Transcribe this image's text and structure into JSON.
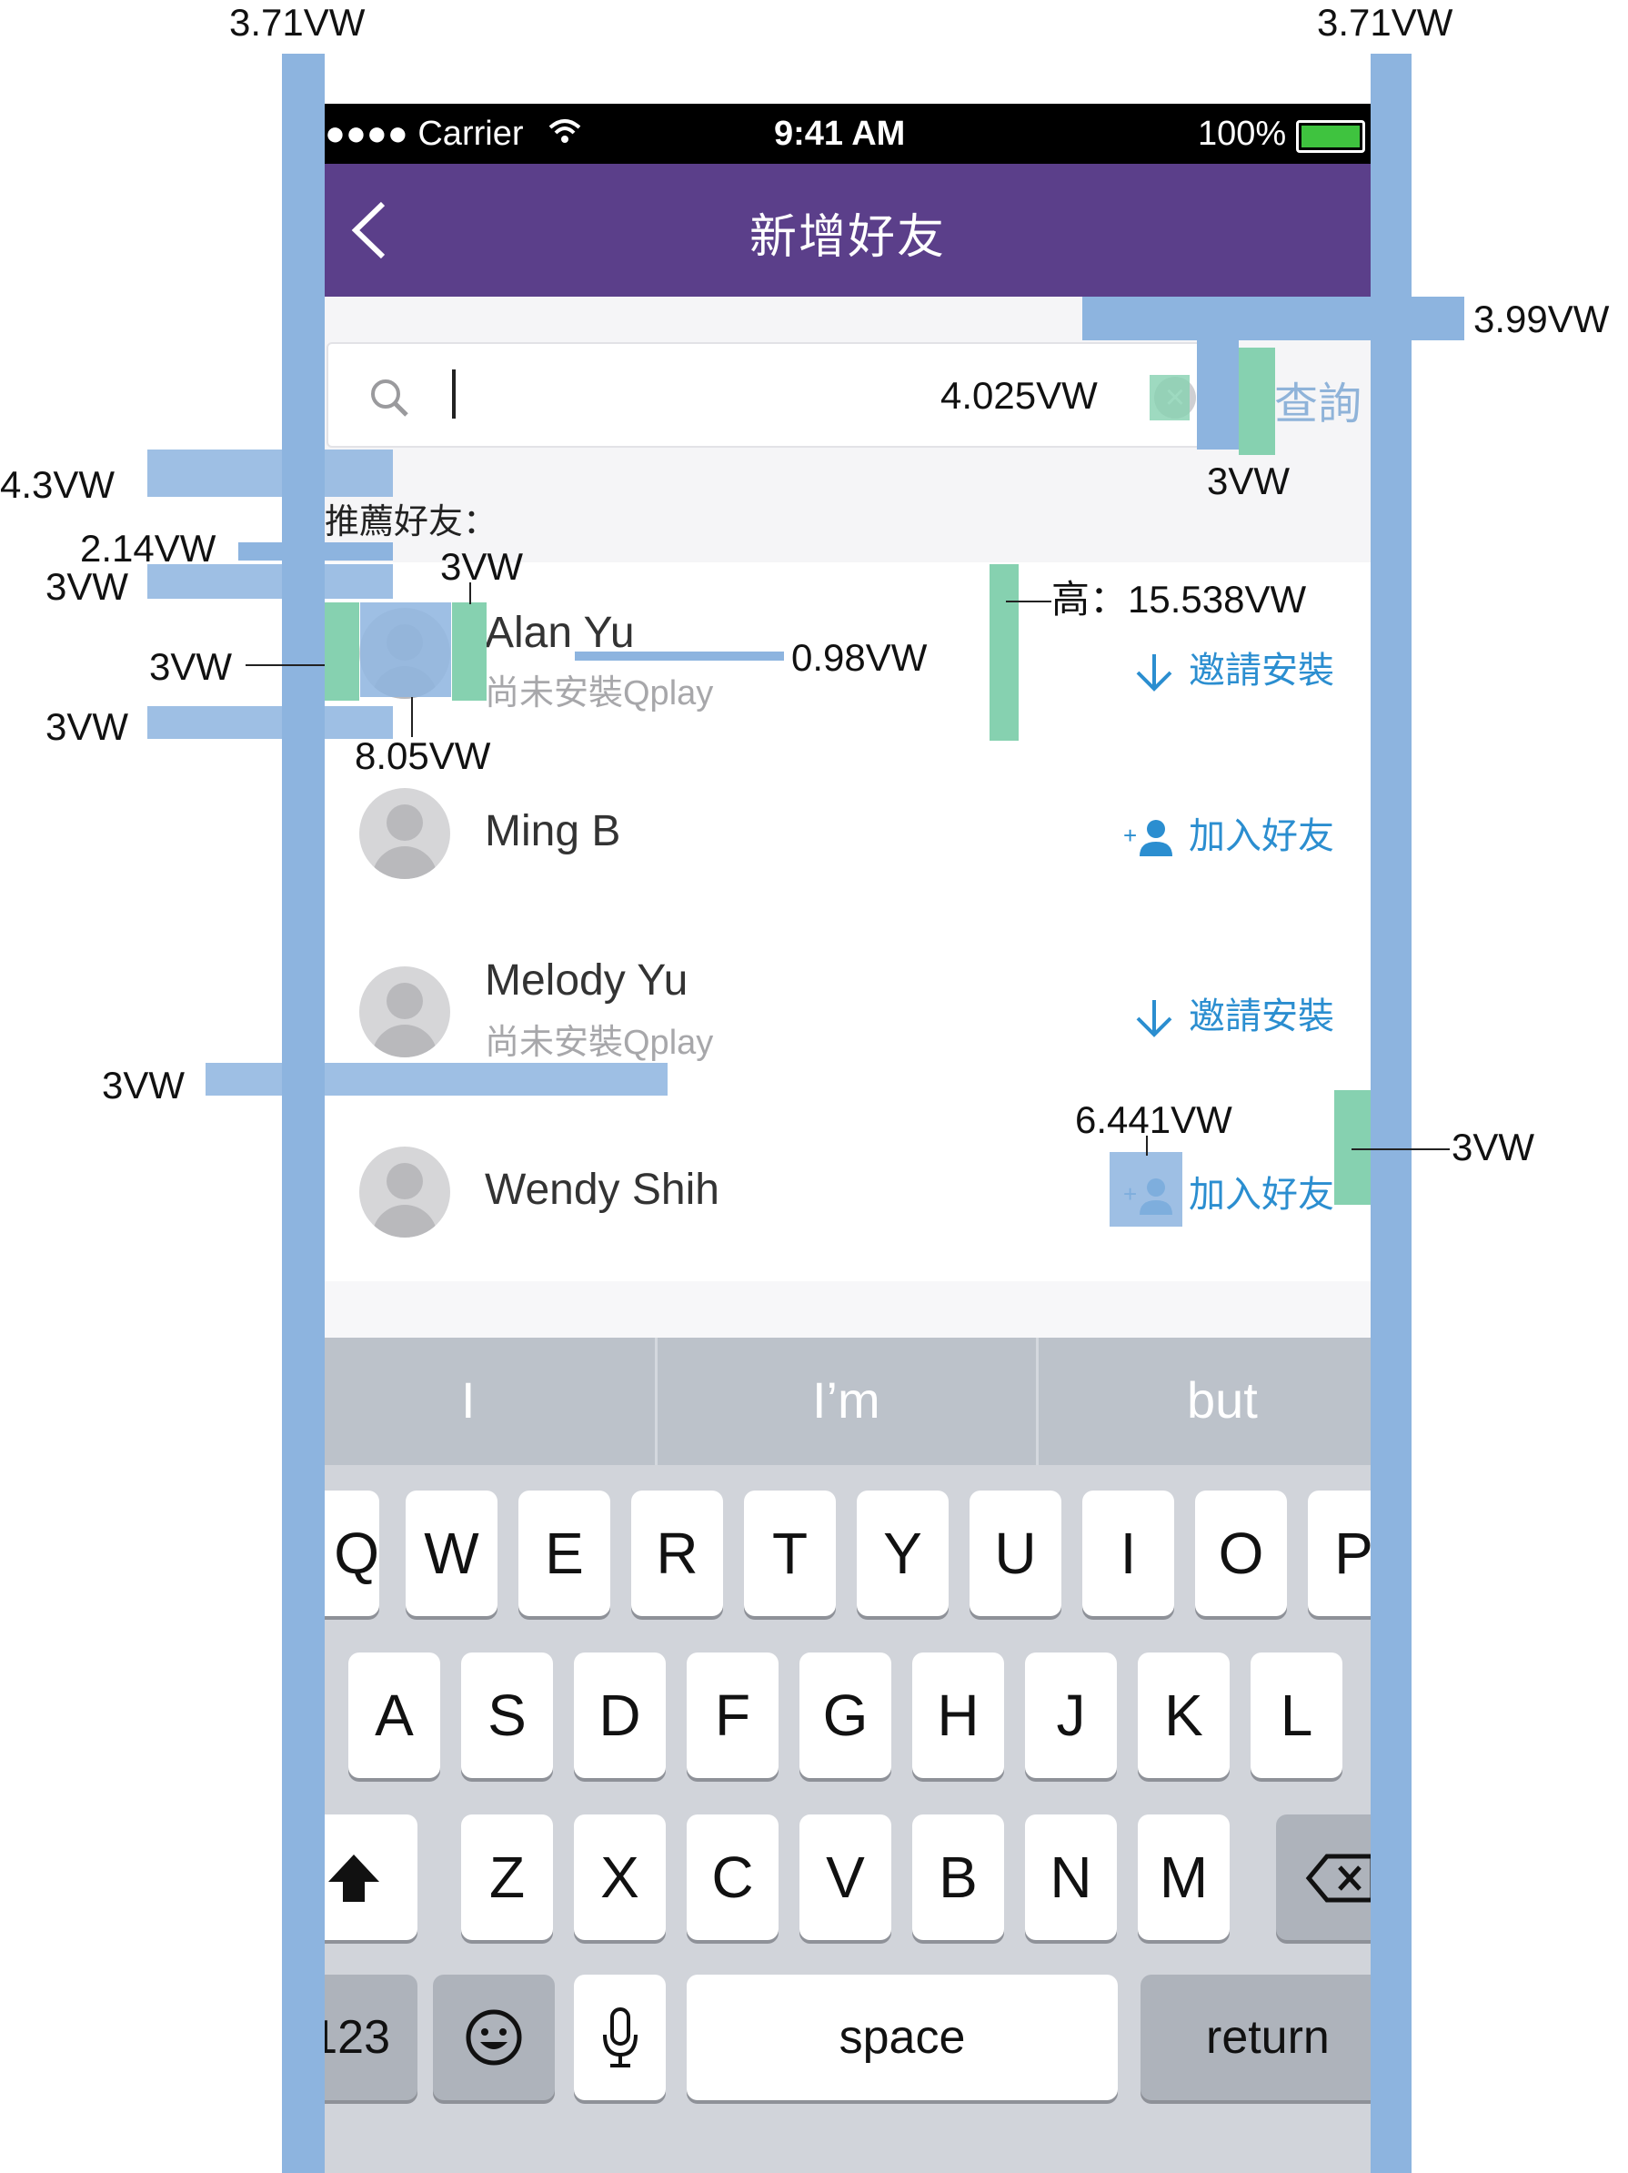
{
  "annotations": {
    "left_top": "3.71VW",
    "right_top": "3.71VW",
    "right_search_gap": "3.99VW",
    "search_clear_gap": "4.025VW",
    "search_button_pad": "3VW",
    "section_top": "4.3VW",
    "section_bottom": "2.14VW",
    "row_top": "3VW",
    "avatar_to_name": "3VW",
    "avatar_left": "3VW",
    "row_bottom": "3VW",
    "avatar_size": "8.05VW",
    "name_gap": "0.98VW",
    "row_height": "高：15.538VW",
    "row_divider": "3VW",
    "icon_size": "6.441VW",
    "right_padding": "3VW"
  },
  "status_bar": {
    "carrier": "●●●● Carrier",
    "time": "9:41 AM",
    "battery": "100%"
  },
  "header": {
    "title": "新增好友"
  },
  "search": {
    "value": "",
    "button": "查詢"
  },
  "section": {
    "label": "推薦好友："
  },
  "contacts": [
    {
      "name": "Alan Yu",
      "sub": "尚未安裝Qplay",
      "action": "邀請安裝",
      "action_icon": "arrow-down-icon"
    },
    {
      "name": "Ming B",
      "sub": "",
      "action": "加入好友",
      "action_icon": "add-user-icon"
    },
    {
      "name": "Melody Yu",
      "sub": "尚未安裝Qplay",
      "action": "邀請安裝",
      "action_icon": "arrow-down-icon"
    },
    {
      "name": "Wendy Shih",
      "sub": "",
      "action": "加入好友",
      "action_icon": "add-user-icon"
    }
  ],
  "keyboard": {
    "predictions": [
      "I",
      "I’m",
      "but"
    ],
    "row1": [
      "Q",
      "W",
      "E",
      "R",
      "T",
      "Y",
      "U",
      "I",
      "O",
      "P"
    ],
    "row2": [
      "A",
      "S",
      "D",
      "F",
      "G",
      "H",
      "J",
      "K",
      "L"
    ],
    "row3": [
      "Z",
      "X",
      "C",
      "V",
      "B",
      "N",
      "M"
    ],
    "numbers": "123",
    "space": "space",
    "return": "return"
  },
  "colors": {
    "header": "#5b3f8a",
    "accent": "#2b8ed0",
    "guide": "#8db4df",
    "guide_green": "#86d1b0"
  }
}
